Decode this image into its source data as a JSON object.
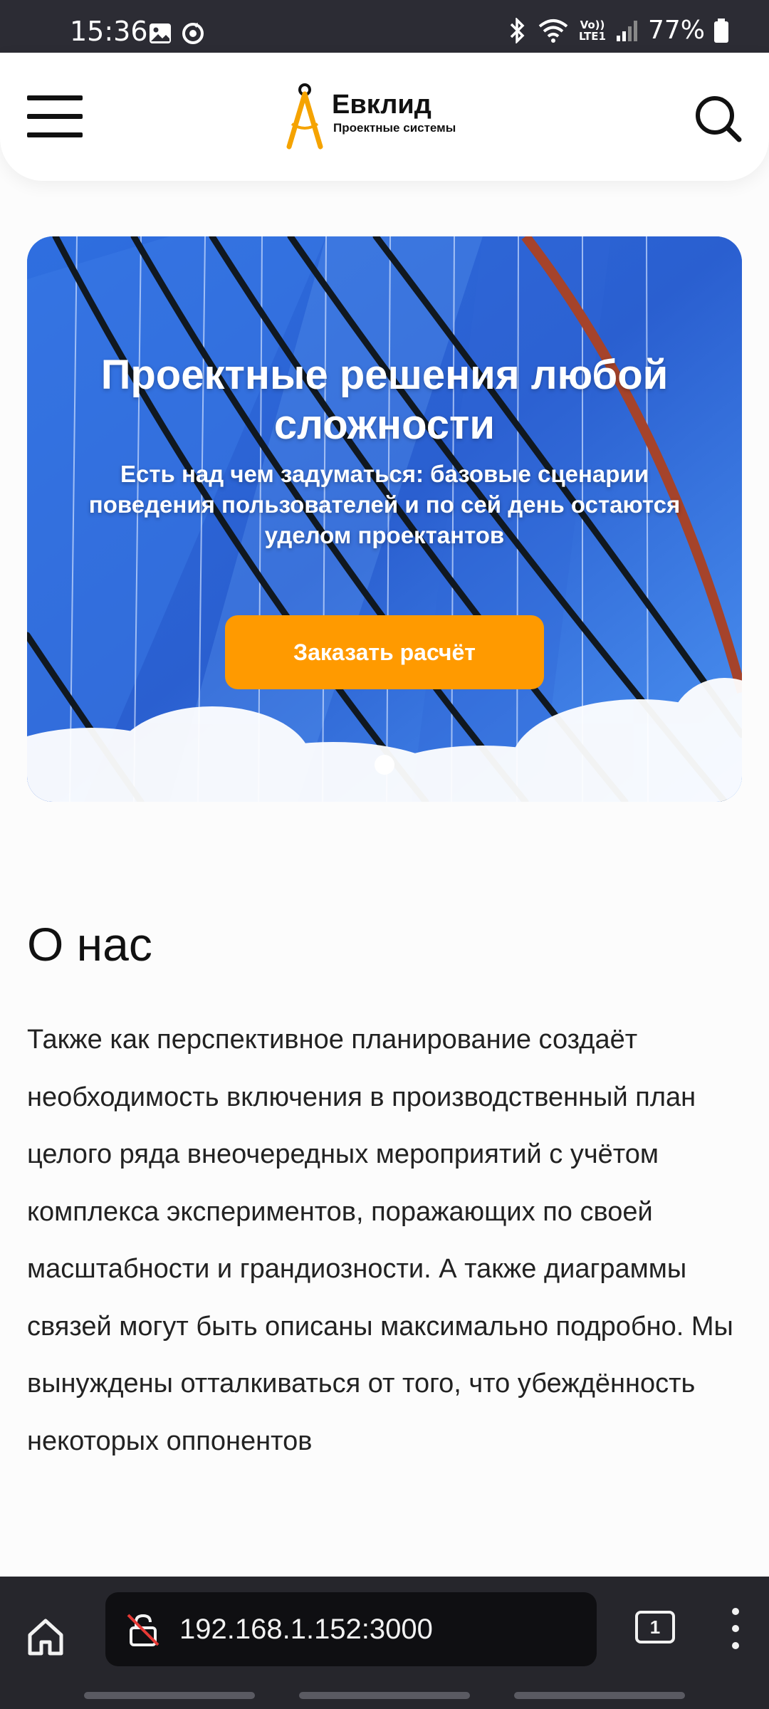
{
  "status_bar": {
    "time": "15:36",
    "network": "Vo)) LTE1",
    "battery": "77%",
    "icons": [
      "image-icon",
      "sync-icon",
      "bluetooth-icon",
      "wifi-icon",
      "signal-icon",
      "battery-icon"
    ]
  },
  "header": {
    "logo_name": "Евклид",
    "logo_tagline": "Проектные системы",
    "menu_icon": "hamburger-menu-icon",
    "search_icon": "search-icon",
    "logo_color": "#f5a300"
  },
  "hero": {
    "title": "Проектные решения любой сложности",
    "subtitle": "Есть над чем задуматься: базовые сценарии поведения пользователей и по сей день остаются уделом проектантов",
    "cta_label": "Заказать расчёт",
    "cta_color": "#ff9a00",
    "slide_count": 1,
    "active_slide": 1
  },
  "about": {
    "title": "О нас",
    "paragraph": "Также как перспективное планирование создаёт необходимость включения в производственный план целого ряда внеочередных мероприятий с учётом комплекса экспериментов, поражающих по своей масштабности и грандиозности. А также диаграммы связей могут быть описаны максимально подробно. Мы вынуждены отталкиваться от того, что убеждённость некоторых оппонентов"
  },
  "browser": {
    "url": "192.168.1.152:3000",
    "tab_count": "1",
    "home_icon": "home-icon",
    "lock_icon": "insecure-lock-icon",
    "menu_icon": "more-vert-icon"
  }
}
